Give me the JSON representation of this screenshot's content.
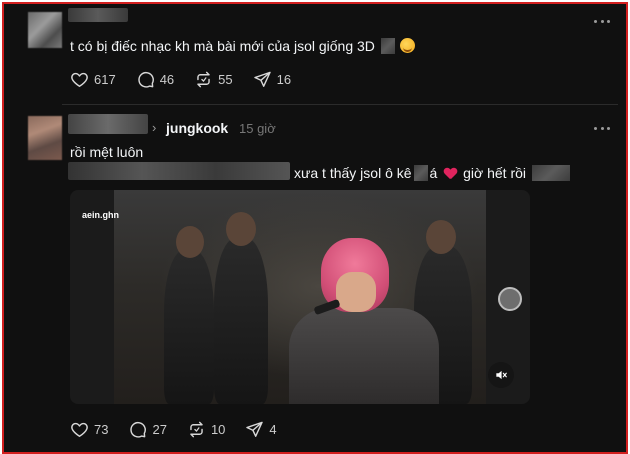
{
  "post1": {
    "text": "t có bị điếc nhạc kh mà bài mới của jsol giống 3D",
    "emoji": "smiling-hearts-emoji",
    "stats": {
      "likes": "617",
      "comments": "46",
      "reposts": "55",
      "shares": "16"
    }
  },
  "post2": {
    "reply_to": "jungkook",
    "time": "15 giờ",
    "line1": "rồi mệt luôn",
    "line2_a": "xưa t thấy jsol ô kê",
    "line2_b": "á",
    "line2_c": "giờ hết rồi",
    "video": {
      "watermark": "aein.ghn"
    },
    "stats": {
      "likes": "73",
      "comments": "27",
      "reposts": "10",
      "shares": "4"
    }
  },
  "colors": {
    "background": "#101010",
    "border": "#d21f1f",
    "text": "#f3f5f7",
    "muted": "#777777",
    "broken_heart": "#e0245e"
  }
}
